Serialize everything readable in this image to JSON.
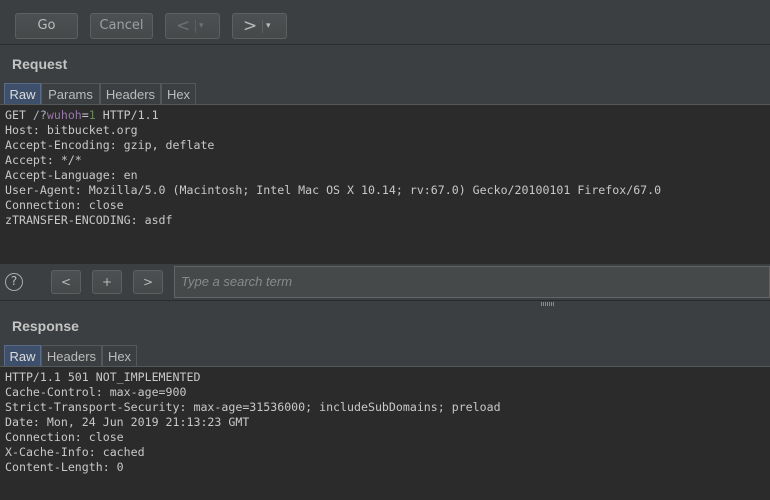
{
  "toolbar": {
    "go_label": "Go",
    "cancel_label": "Cancel",
    "back_arrow": "<",
    "forward_arrow": ">",
    "dropdown_caret": "▾"
  },
  "request": {
    "title": "Request",
    "tabs": [
      "Raw",
      "Params",
      "Headers",
      "Hex"
    ],
    "active_tab": "Raw",
    "lines": [
      {
        "pre": "GET ",
        "path": "/?",
        "key": "wuhoh",
        "eq": "=",
        "val": "1",
        "post": " HTTP/1.1"
      },
      "Host: bitbucket.org",
      "Accept-Encoding: gzip, deflate",
      "Accept: */*",
      "Accept-Language: en",
      "User-Agent: Mozilla/5.0 (Macintosh; Intel Mac OS X 10.14; rv:67.0) Gecko/20100101 Firefox/67.0",
      "Connection: close",
      "zTRANSFER-ENCODING: asdf"
    ]
  },
  "search": {
    "help": "?",
    "prev": "<",
    "add": "+",
    "next": ">",
    "placeholder": "Type a search term"
  },
  "response": {
    "title": "Response",
    "tabs": [
      "Raw",
      "Headers",
      "Hex"
    ],
    "active_tab": "Raw",
    "lines": [
      "HTTP/1.1 501 NOT_IMPLEMENTED",
      "Cache-Control: max-age=900",
      "Strict-Transport-Security: max-age=31536000; includeSubDomains; preload",
      "Date: Mon, 24 Jun 2019 21:13:23 GMT",
      "Connection: close",
      "X-Cache-Info: cached",
      "Content-Length: 0"
    ]
  },
  "colors": {
    "background": "#3c3f41",
    "editor_background": "#2b2b2b",
    "active_tab": "#3e4f6b",
    "param_key": "#9876aa",
    "param_value": "#6a8759"
  }
}
